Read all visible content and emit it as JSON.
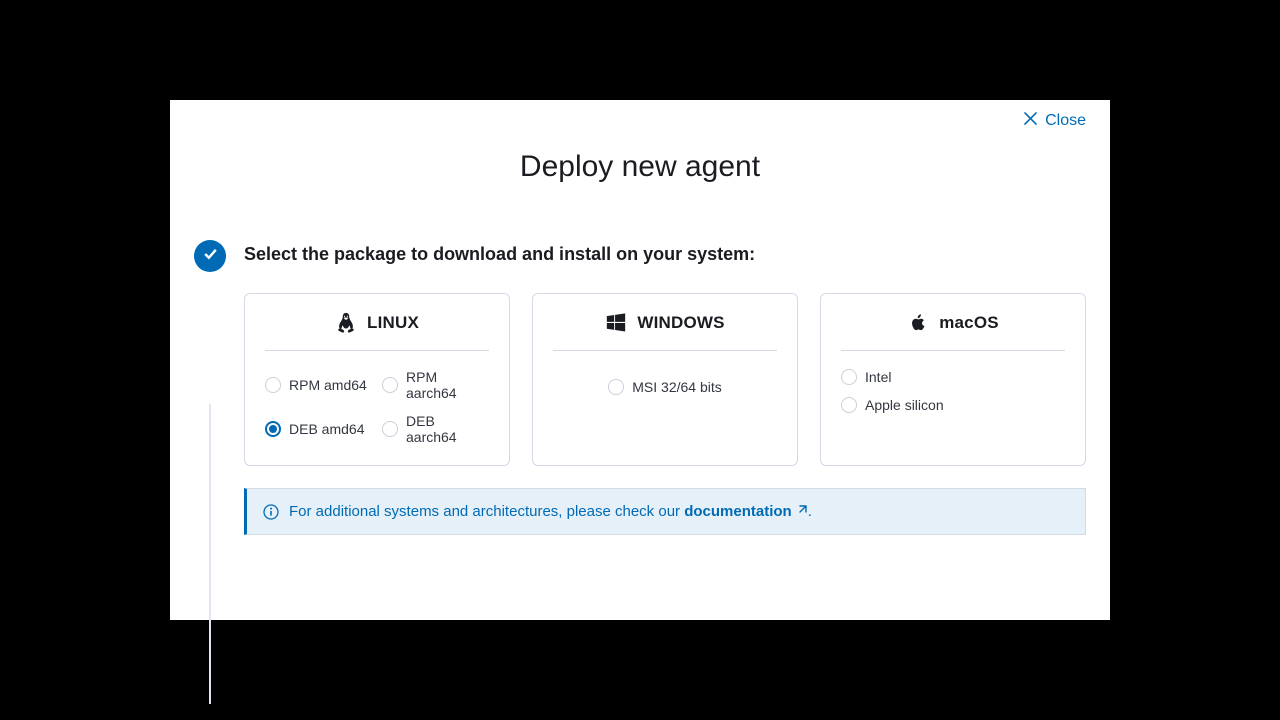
{
  "header": {
    "close_label": "Close",
    "title": "Deploy new agent"
  },
  "step": {
    "title": "Select the package to download and install on your system:"
  },
  "os": {
    "linux": {
      "label": "LINUX",
      "options": {
        "rpm_amd64": {
          "label": "RPM amd64",
          "selected": false
        },
        "rpm_aarch64": {
          "label": "RPM aarch64",
          "selected": false
        },
        "deb_amd64": {
          "label": "DEB amd64",
          "selected": true
        },
        "deb_aarch64": {
          "label": "DEB aarch64",
          "selected": false
        }
      }
    },
    "windows": {
      "label": "WINDOWS",
      "options": {
        "msi": {
          "label": "MSI 32/64 bits",
          "selected": false
        }
      }
    },
    "macos": {
      "label": "macOS",
      "options": {
        "intel": {
          "label": "Intel",
          "selected": false
        },
        "silicon": {
          "label": "Apple silicon",
          "selected": false
        }
      }
    }
  },
  "callout": {
    "text_prefix": "For additional systems and architectures, please check our ",
    "link_label": "documentation",
    "text_suffix": "."
  }
}
